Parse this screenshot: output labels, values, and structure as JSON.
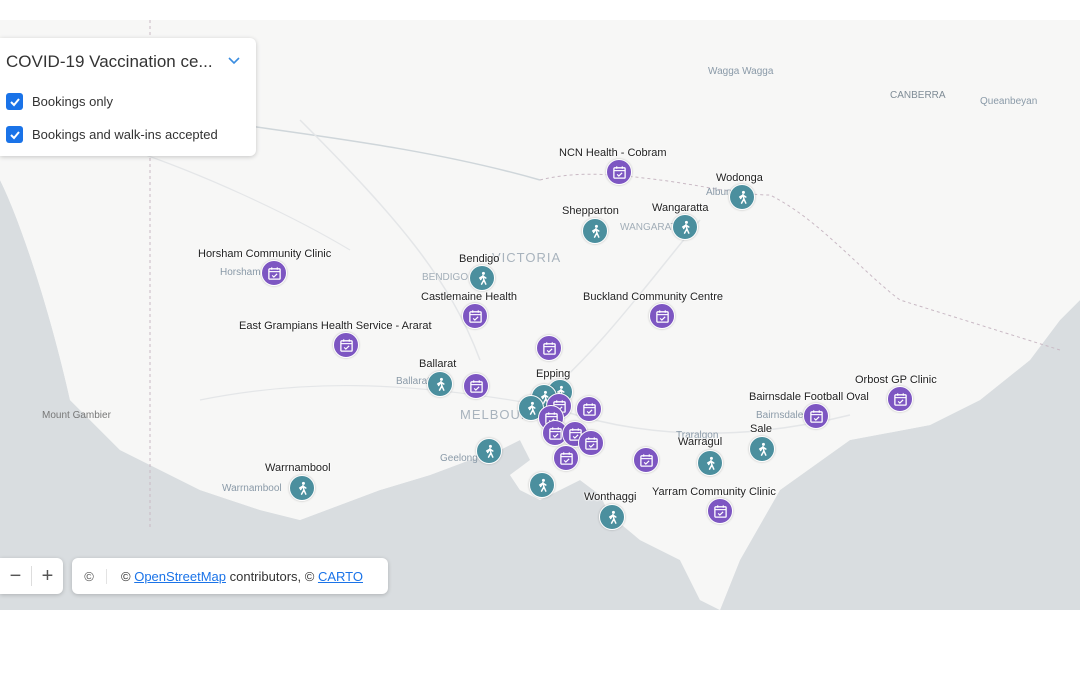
{
  "colors": {
    "booking": "#7d56c2",
    "walkin": "#4b8f9e",
    "land": "#f7f7f6",
    "sea": "#d9dde0",
    "checkbox": "#1a73e8"
  },
  "legend": {
    "title": "COVID-19 Vaccination ce...",
    "items": [
      {
        "label": "Bookings only",
        "checked": true
      },
      {
        "label": "Bookings and walk-ins accepted",
        "checked": true
      }
    ]
  },
  "map": {
    "state_label": "VICTORIA",
    "places": [
      "Wagga Wagga",
      "CANBERRA",
      "Queanbeyan",
      "Albury",
      "WANGARATTA",
      "BENDIGO",
      "Horsham",
      "Ballarat",
      "MELBOURNE",
      "Mount Gambier",
      "Geelong",
      "Warrnambool",
      "Traralgon",
      "Bairnsdale"
    ],
    "sites": [
      {
        "label": "NCN Health - Cobram",
        "kind": "booking"
      },
      {
        "label": "Wodonga",
        "kind": "walkin"
      },
      {
        "label": "Shepparton",
        "kind": "walkin"
      },
      {
        "label": "Wangaratta",
        "kind": "walkin"
      },
      {
        "label": "Horsham Community Clinic",
        "kind": "booking"
      },
      {
        "label": "Bendigo",
        "kind": "walkin"
      },
      {
        "label": "Castlemaine Health",
        "kind": "booking"
      },
      {
        "label": "Buckland Community Centre",
        "kind": "booking"
      },
      {
        "label": "East Grampians Health Service - Ararat",
        "kind": "booking"
      },
      {
        "label": "Ballarat",
        "kind": "walkin"
      },
      {
        "label": "Epping",
        "kind": "walkin"
      },
      {
        "label": "Bairnsdale Football Oval",
        "kind": "booking"
      },
      {
        "label": "Orbost GP Clinic",
        "kind": "booking"
      },
      {
        "label": "Warragul",
        "kind": "walkin"
      },
      {
        "label": "Sale",
        "kind": "walkin"
      },
      {
        "label": "Warrnambool",
        "kind": "walkin"
      },
      {
        "label": "Wonthaggi",
        "kind": "walkin"
      },
      {
        "label": "Yarram Community Clinic",
        "kind": "booking"
      }
    ]
  },
  "zoom": {
    "out": "−",
    "in": "+"
  },
  "attribution": {
    "icon": "©",
    "prefix": "© ",
    "osm": "OpenStreetMap",
    "middle": " contributors, © ",
    "carto": "CARTO"
  }
}
